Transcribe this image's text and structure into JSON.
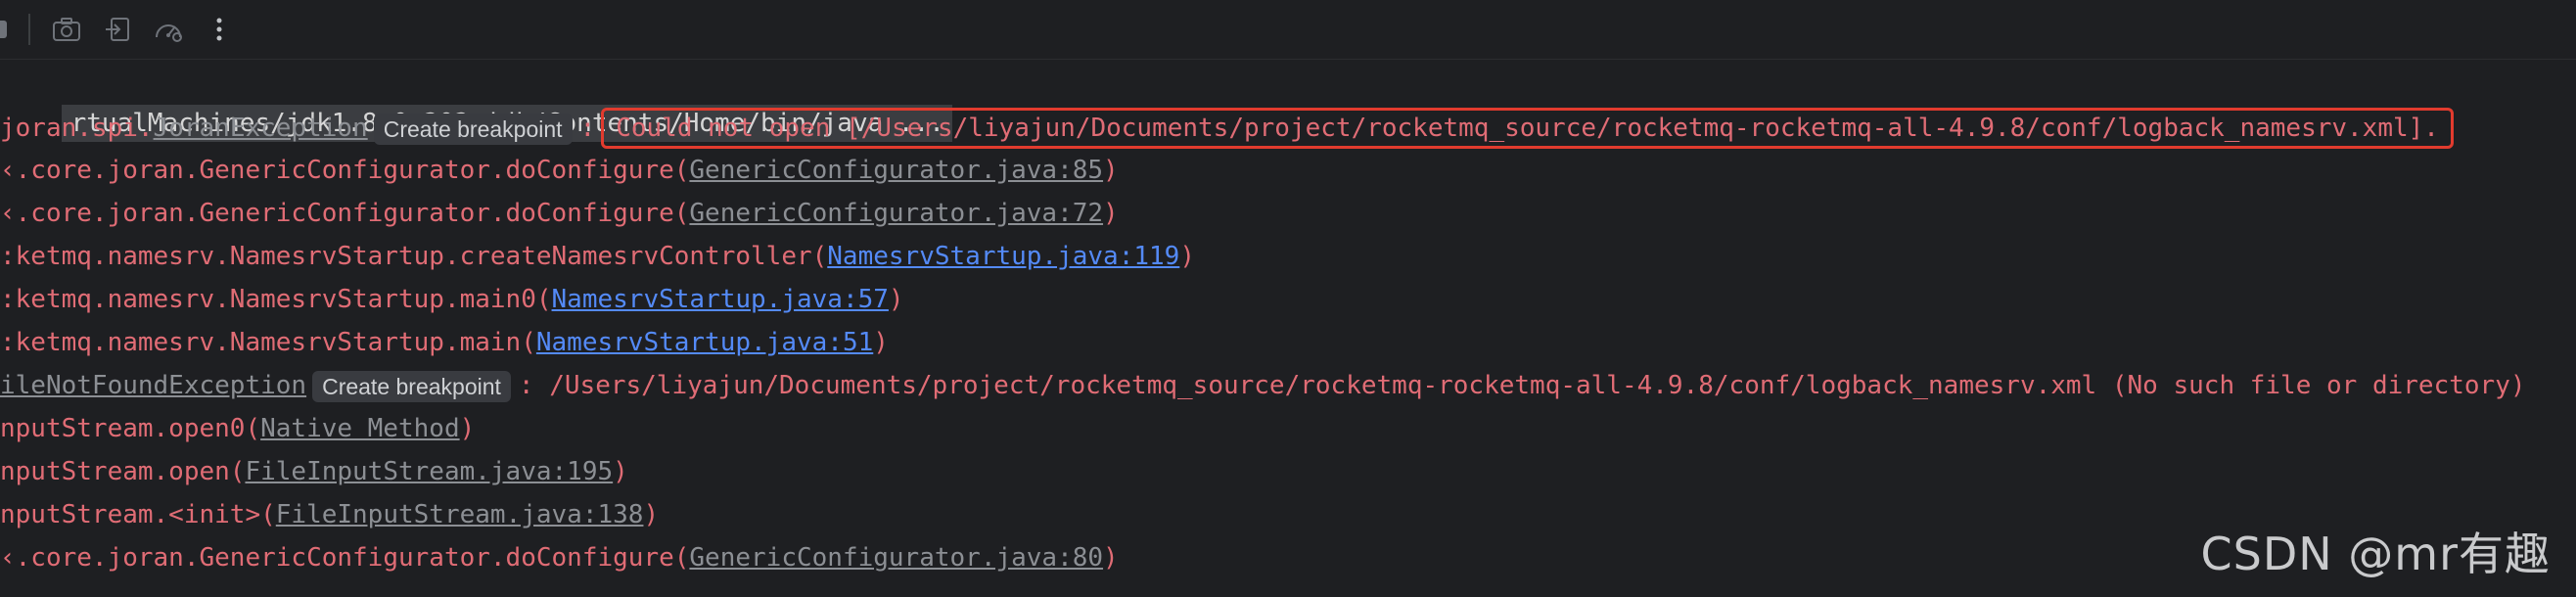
{
  "toolbar": {
    "icons": [
      "stop-icon",
      "camera-icon",
      "login-icon",
      "dashboard-icon",
      "more-vertical-icon"
    ]
  },
  "console": {
    "command_line": "rtualMachines/jdk1.8.0_202.jdk/Contents/Home/bin/java ...",
    "line1": {
      "prefix": "joran.spi.",
      "exception": "JoranException",
      "breakpoint": "Create breakpoint",
      "colon": ":",
      "message": "Could not open [/Users/liyajun/Documents/project/rocketmq_source/rocketmq-rocketmq-all-4.9.8/conf/logback_namesrv.xml]."
    },
    "line2": {
      "prefix": "‹.core.joran.GenericConfigurator.doConfigure(",
      "link": "GenericConfigurator.java:85",
      "suffix": ")"
    },
    "line3": {
      "prefix": "‹.core.joran.GenericConfigurator.doConfigure(",
      "link": "GenericConfigurator.java:72",
      "suffix": ")"
    },
    "line4": {
      "prefix": ":ketmq.namesrv.NamesrvStartup.createNamesrvController(",
      "link": "NamesrvStartup.java:119",
      "suffix": ")"
    },
    "line5": {
      "prefix": ":ketmq.namesrv.NamesrvStartup.main0(",
      "link": "NamesrvStartup.java:57",
      "suffix": ")"
    },
    "line6": {
      "prefix": ":ketmq.namesrv.NamesrvStartup.main(",
      "link": "NamesrvStartup.java:51",
      "suffix": ")"
    },
    "line7": {
      "exception": "ileNotFoundException",
      "breakpoint": "Create breakpoint",
      "message": ": /Users/liyajun/Documents/project/rocketmq_source/rocketmq-rocketmq-all-4.9.8/conf/logback_namesrv.xml (No such file or directory)"
    },
    "line8": {
      "prefix": "nputStream.open0(",
      "link": "Native Method",
      "suffix": ")"
    },
    "line9": {
      "prefix": "nputStream.open(",
      "link": "FileInputStream.java:195",
      "suffix": ")"
    },
    "line10": {
      "prefix": "nputStream.<init>(",
      "link": "FileInputStream.java:138",
      "suffix": ")"
    },
    "line11": {
      "prefix": "‹.core.joran.GenericConfigurator.doConfigure(",
      "link": "GenericConfigurator.java:80",
      "suffix": ")"
    }
  },
  "watermark": "CSDN @mr有趣",
  "colors": {
    "background": "#1e1f22",
    "error_text": "#e06c75",
    "link_blue": "#548af7",
    "link_gray": "#8c8f94",
    "highlight_box": "#e23b2e"
  }
}
